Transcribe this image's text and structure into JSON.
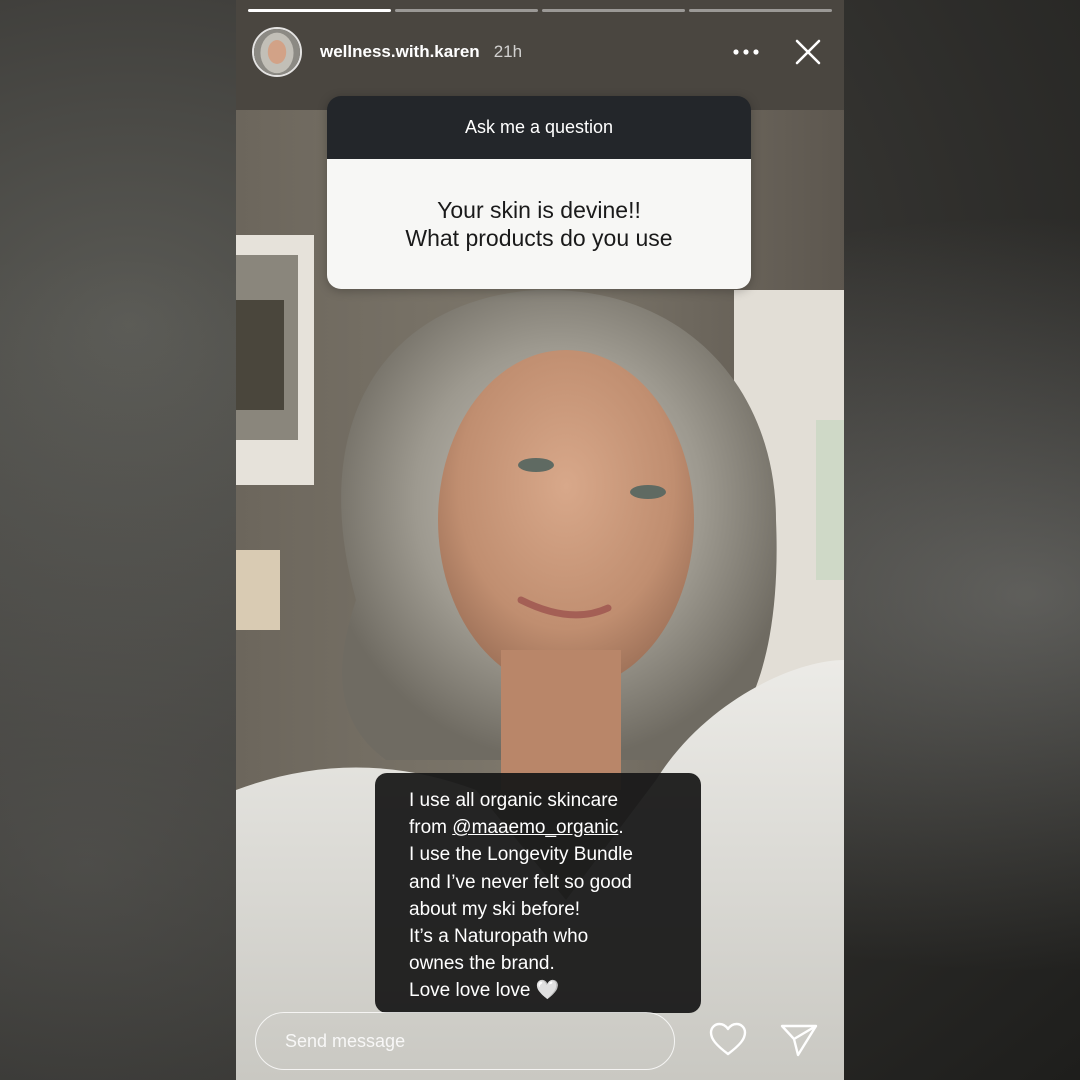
{
  "story": {
    "progress": {
      "segments": 4,
      "active_index": 0
    },
    "header": {
      "username": "wellness.with.karen",
      "time_ago": "21h",
      "more_icon": "more-horizontal-icon",
      "close_icon": "close-icon"
    },
    "question_sticker": {
      "title": "Ask me a question",
      "question_lines": [
        "Your skin is devine!!",
        "What products do you use"
      ]
    },
    "answer": {
      "line1": "I use all organic skincare",
      "line2_prefix": "from ",
      "mention": "@maaemo_organic",
      "line2_suffix": ".",
      "line3": "I use the Longevity Bundle",
      "line4": "and I’ve never felt so good",
      "line5": "about my ski before!",
      "line6": "It’s a Naturopath who",
      "line7": "ownes the brand.",
      "line8": "Love love love",
      "emoji": "🤍"
    },
    "composer": {
      "placeholder": "Send message",
      "like_icon": "heart-icon",
      "send_icon": "send-icon"
    }
  }
}
